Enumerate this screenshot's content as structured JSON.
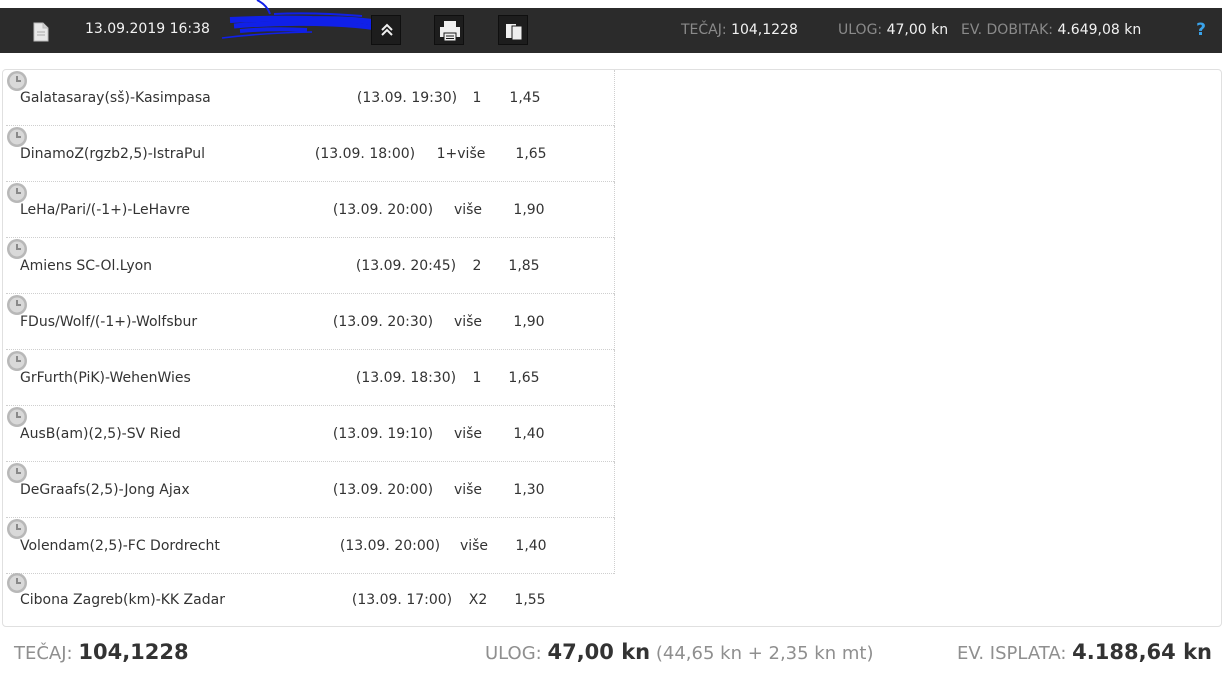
{
  "header": {
    "date": "13.09.2019 16:38",
    "tecaj_label": "TEČAJ:",
    "tecaj_value": "104,1228",
    "ulog_label": "ULOG:",
    "ulog_value": "47,00 kn",
    "dobitak_label": "EV. DOBITAK:",
    "dobitak_value": "4.649,08 kn",
    "help": "?"
  },
  "bets": [
    {
      "match": "Galatasaray(sš)-Kasimpasa",
      "time": "(13.09. 19:30)",
      "tip": "1",
      "odd": "1,45"
    },
    {
      "match": "DinamoZ(rgzb2,5)-IstraPul",
      "time": "(13.09. 18:00)",
      "tip": "1+više",
      "odd": "1,65"
    },
    {
      "match": "LeHa/Pari/(-1+)-LeHavre",
      "time": "(13.09. 20:00)",
      "tip": "više",
      "odd": "1,90"
    },
    {
      "match": "Amiens SC-Ol.Lyon",
      "time": "(13.09. 20:45)",
      "tip": "2",
      "odd": "1,85"
    },
    {
      "match": "FDus/Wolf/(-1+)-Wolfsbur",
      "time": "(13.09. 20:30)",
      "tip": "više",
      "odd": "1,90"
    },
    {
      "match": "GrFurth(PiK)-WehenWies",
      "time": "(13.09. 18:30)",
      "tip": "1",
      "odd": "1,65"
    },
    {
      "match": "AusB(am)(2,5)-SV Ried",
      "time": "(13.09. 19:10)",
      "tip": "više",
      "odd": "1,40"
    },
    {
      "match": "DeGraafs(2,5)-Jong Ajax",
      "time": "(13.09. 20:00)",
      "tip": "više",
      "odd": "1,30"
    },
    {
      "match": "Volendam(2,5)-FC Dordrecht",
      "time": "(13.09. 20:00)",
      "tip": "više",
      "odd": "1,40"
    },
    {
      "match": "Cibona Zagreb(km)-KK Zadar",
      "time": "(13.09. 17:00)",
      "tip": "X2",
      "odd": "1,55"
    }
  ],
  "footer": {
    "tecaj_label": "TEČAJ:",
    "tecaj_value": "104,1228",
    "ulog_label": "ULOG:",
    "ulog_value": "47,00 kn",
    "ulog_breakdown": "(44,65 kn + 2,35 kn mt)",
    "isplata_label": "EV. ISPLATA:",
    "isplata_value": "4.188,64 kn"
  },
  "icons": {
    "document": "document-icon",
    "collapse": "chevron-up-icon",
    "print": "printer-icon",
    "copy": "copy-icon",
    "clock": "clock-icon"
  }
}
